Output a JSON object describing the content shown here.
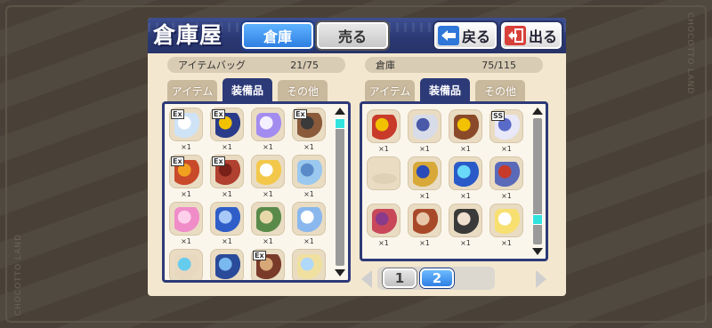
{
  "watermark": "CHOCOTTO LAND",
  "header": {
    "title": "倉庫屋",
    "tab_warehouse": "倉庫",
    "tab_sell": "売る",
    "back_label": "戻る",
    "exit_label": "出る"
  },
  "left_panel": {
    "title": "アイテムバッグ",
    "count": "21/75",
    "tabs": [
      "アイテム",
      "装備品",
      "その他"
    ],
    "active_tab": "装備品",
    "items": [
      {
        "tag": "Ex",
        "qty": "×1",
        "color": "#cfe3f7",
        "accent": "#ffffff"
      },
      {
        "tag": "Ex",
        "qty": "×1",
        "color": "#2a3b8a",
        "accent": "#f2c200"
      },
      {
        "tag": "",
        "qty": "×1",
        "color": "#a38cf0",
        "accent": "#f4f0ff"
      },
      {
        "tag": "Ex",
        "qty": "×1",
        "color": "#8a5a3a",
        "accent": "#3a3a3a"
      },
      {
        "tag": "Ex",
        "qty": "×1",
        "color": "#c84a2a",
        "accent": "#f2a020"
      },
      {
        "tag": "Ex",
        "qty": "×1",
        "color": "#b04030",
        "accent": "#7a2018"
      },
      {
        "tag": "",
        "qty": "×1",
        "color": "#f3c84a",
        "accent": "#ffffff"
      },
      {
        "tag": "",
        "qty": "×1",
        "color": "#9ac8ee",
        "accent": "#5a8ac8"
      },
      {
        "tag": "",
        "qty": "×1",
        "color": "#f08cc8",
        "accent": "#ffd0ec"
      },
      {
        "tag": "",
        "qty": "×1",
        "color": "#2f5ec8",
        "accent": "#a8c8f8"
      },
      {
        "tag": "",
        "qty": "×1",
        "color": "#5a8a4a",
        "accent": "#e8d8a8"
      },
      {
        "tag": "",
        "qty": "×1",
        "color": "#8ab8ee",
        "accent": "#ffffff"
      },
      {
        "tag": "",
        "qty": "",
        "color": "#e8d8c0",
        "accent": "#66ccee"
      },
      {
        "tag": "",
        "qty": "",
        "color": "#2a4a9a",
        "accent": "#7ab8f0"
      },
      {
        "tag": "Ex",
        "qty": "",
        "color": "#7a3a2a",
        "accent": "#d8a878"
      },
      {
        "tag": "",
        "qty": "",
        "color": "#f0e0a0",
        "accent": "#b0d8f8"
      }
    ]
  },
  "right_panel": {
    "title": "倉庫",
    "count": "75/115",
    "tabs": [
      "アイテム",
      "装備品",
      "その他"
    ],
    "active_tab": "装備品",
    "items": [
      {
        "tag": "",
        "qty": "×1",
        "color": "#c83a2a",
        "accent": "#f2c200"
      },
      {
        "tag": "",
        "qty": "×1",
        "color": "#d8dce8",
        "accent": "#4a5aa8"
      },
      {
        "tag": "",
        "qty": "×1",
        "color": "#8a4a2a",
        "accent": "#f2c200"
      },
      {
        "tag": "SS",
        "qty": "×1",
        "color": "#e8e8f8",
        "accent": "#5a6ac8"
      },
      {
        "tag": "",
        "qty": "",
        "color": "",
        "accent": "",
        "empty": true
      },
      {
        "tag": "",
        "qty": "×1",
        "color": "#d8a838",
        "accent": "#2a4ab8"
      },
      {
        "tag": "",
        "qty": "×1",
        "color": "#2a5ac8",
        "accent": "#6ad8f8"
      },
      {
        "tag": "",
        "qty": "×1",
        "color": "#5a6ab8",
        "accent": "#c83a2a"
      },
      {
        "tag": "",
        "qty": "×1",
        "color": "#c8485a",
        "accent": "#8a3a8a"
      },
      {
        "tag": "",
        "qty": "×1",
        "color": "#a84a2a",
        "accent": "#e8c8a8"
      },
      {
        "tag": "",
        "qty": "×1",
        "color": "#3a3a3a",
        "accent": "#f0e0d0"
      },
      {
        "tag": "",
        "qty": "×1",
        "color": "#f8e070",
        "accent": "#ffffff"
      }
    ],
    "pages": [
      "1",
      "2"
    ],
    "current_page": "2"
  }
}
